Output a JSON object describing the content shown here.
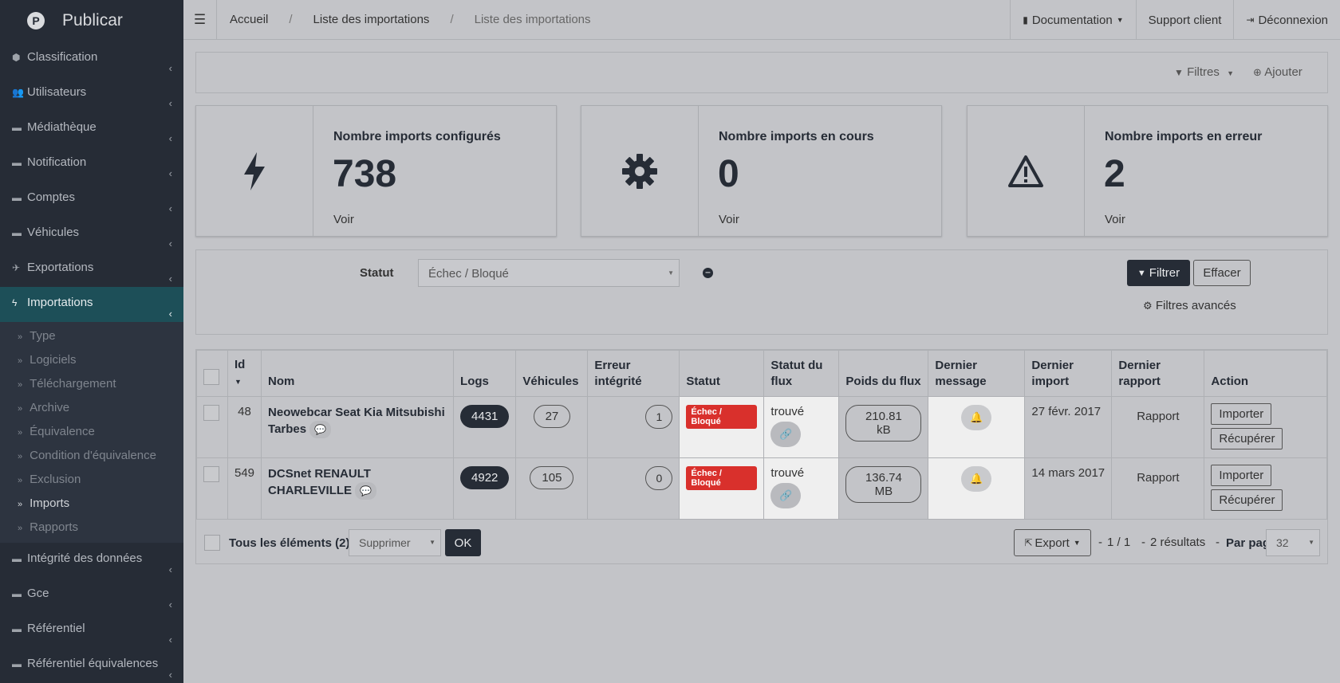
{
  "brand": {
    "name": "Publicar",
    "logo_letter": "P"
  },
  "sidebar": {
    "items": [
      {
        "label": "Classification",
        "icon": "tags-icon",
        "glyph": "⬢"
      },
      {
        "label": "Utilisateurs",
        "icon": "users-icon",
        "glyph": "👥"
      },
      {
        "label": "Médiathèque",
        "icon": "folder-icon",
        "glyph": "▬"
      },
      {
        "label": "Notification",
        "icon": "folder-icon",
        "glyph": "▬"
      },
      {
        "label": "Comptes",
        "icon": "folder-icon",
        "glyph": "▬"
      },
      {
        "label": "Véhicules",
        "icon": "folder-icon",
        "glyph": "▬"
      },
      {
        "label": "Exportations",
        "icon": "paper-plane-icon",
        "glyph": "✈"
      },
      {
        "label": "Importations",
        "icon": "bolt-icon",
        "glyph": "ϟ"
      }
    ],
    "sub_items": [
      "Type",
      "Logiciels",
      "Téléchargement",
      "Archive",
      "Équivalence",
      "Condition d'équivalence",
      "Exclusion",
      "Imports",
      "Rapports"
    ],
    "bottom_items": [
      {
        "label": "Intégrité des données",
        "icon": "folder-icon",
        "glyph": "▬"
      },
      {
        "label": "Gce",
        "icon": "folder-icon",
        "glyph": "▬"
      },
      {
        "label": "Référentiel",
        "icon": "folder-icon",
        "glyph": "▬"
      },
      {
        "label": "Référentiel équivalences",
        "icon": "folder-icon",
        "glyph": "▬"
      }
    ]
  },
  "topbar": {
    "breadcrumb": [
      "Accueil",
      "Liste des importations",
      "Liste des importations"
    ],
    "documentation": "Documentation",
    "support": "Support client",
    "logout": "Déconnexion"
  },
  "toolbar": {
    "filters": "Filtres",
    "add": "Ajouter"
  },
  "cards": [
    {
      "title": "Nombre imports configurés",
      "value": "738",
      "link": "Voir",
      "icon": "bolt-icon"
    },
    {
      "title": "Nombre imports en cours",
      "value": "0",
      "link": "Voir",
      "icon": "gear-icon"
    },
    {
      "title": "Nombre imports en erreur",
      "value": "2",
      "link": "Voir",
      "icon": "warning-icon"
    }
  ],
  "filter": {
    "label": "Statut",
    "selected": "Échec / Bloqué",
    "filter_btn": "Filtrer",
    "clear_btn": "Effacer",
    "advanced": "Filtres avancés"
  },
  "table": {
    "headers": {
      "id": "Id",
      "nom": "Nom",
      "logs": "Logs",
      "vehicules": "Véhicules",
      "erreur": "Erreur intégrité",
      "statut": "Statut",
      "statut_flux": "Statut du flux",
      "poids": "Poids du flux",
      "dernier_message": "Dernier message",
      "dernier_import": "Dernier import",
      "dernier_rapport": "Dernier rapport",
      "action": "Action"
    },
    "rows": [
      {
        "id": "48",
        "nom": "Neowebcar Seat Kia Mitsubishi Tarbes",
        "logs": "4431",
        "vehicules": "27",
        "erreur": "1",
        "statut": "Échec / Bloqué",
        "flux": "trouvé",
        "poids": "210.81 kB",
        "import": "27 févr. 2017",
        "rapport": "Rapport",
        "btn_import": "Importer",
        "btn_recup": "Récupérer"
      },
      {
        "id": "549",
        "nom": "DCSnet RENAULT CHARLEVILLE",
        "logs": "4922",
        "vehicules": "105",
        "erreur": "0",
        "statut": "Échec / Bloqué",
        "flux": "trouvé",
        "poids": "136.74 MB",
        "import": "14 mars 2017",
        "rapport": "Rapport",
        "btn_import": "Importer",
        "btn_recup": "Récupérer"
      }
    ],
    "footer": {
      "all_elements": "Tous les éléments (2)",
      "bulk_action": "Supprimer",
      "ok": "OK",
      "export": "Export",
      "pages": "1 / 1",
      "results": "2 résultats",
      "per_page_label": "Par page",
      "per_page": "32"
    }
  }
}
